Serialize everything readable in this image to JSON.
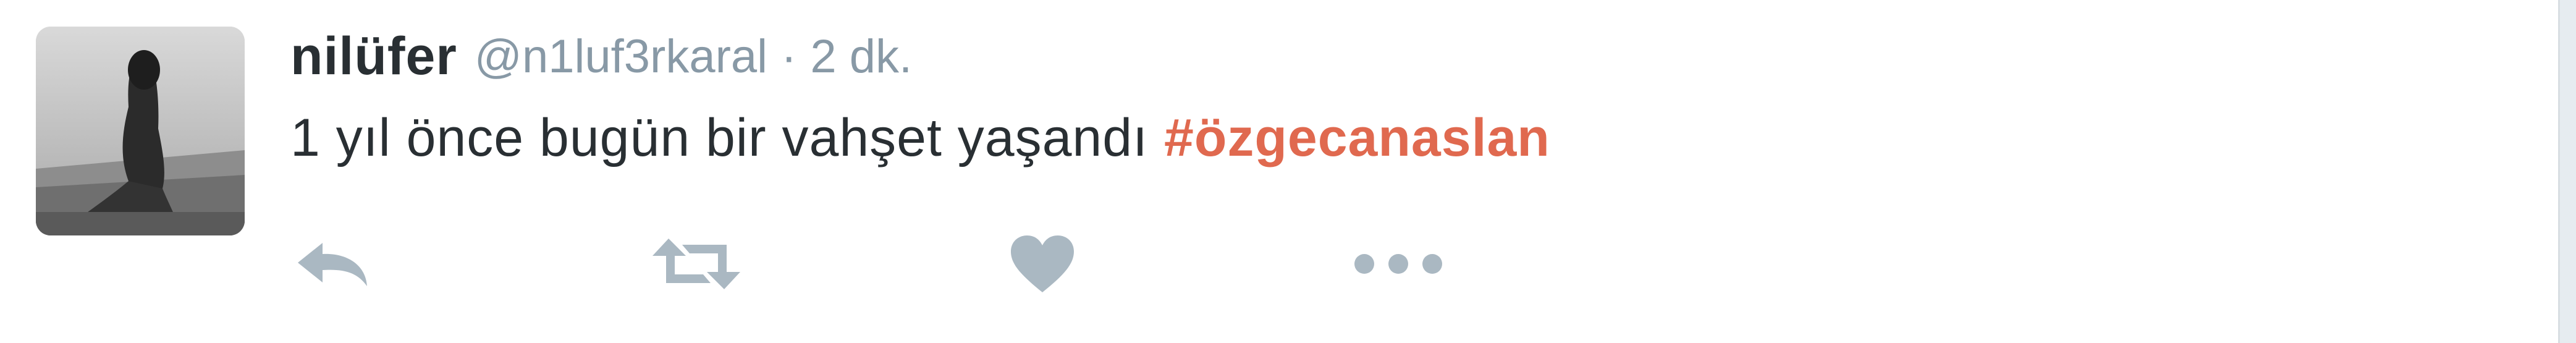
{
  "tweet": {
    "author": {
      "name": "nilüfer",
      "handle": "@n1luf3rkaral",
      "avatar_icon": "profile-photo"
    },
    "separator": "·",
    "timestamp": "2 dk.",
    "text": "1 yıl önce bugün bir vahşet yaşandı",
    "hashtag": "#özgecanaslan",
    "colors": {
      "name": "#292f33",
      "meta": "#8899a6",
      "hashtag": "#e0694f",
      "action_icon": "#aab8c2"
    },
    "actions": [
      {
        "icon": "reply-icon"
      },
      {
        "icon": "retweet-icon"
      },
      {
        "icon": "heart-icon"
      },
      {
        "icon": "more-icon"
      }
    ]
  }
}
